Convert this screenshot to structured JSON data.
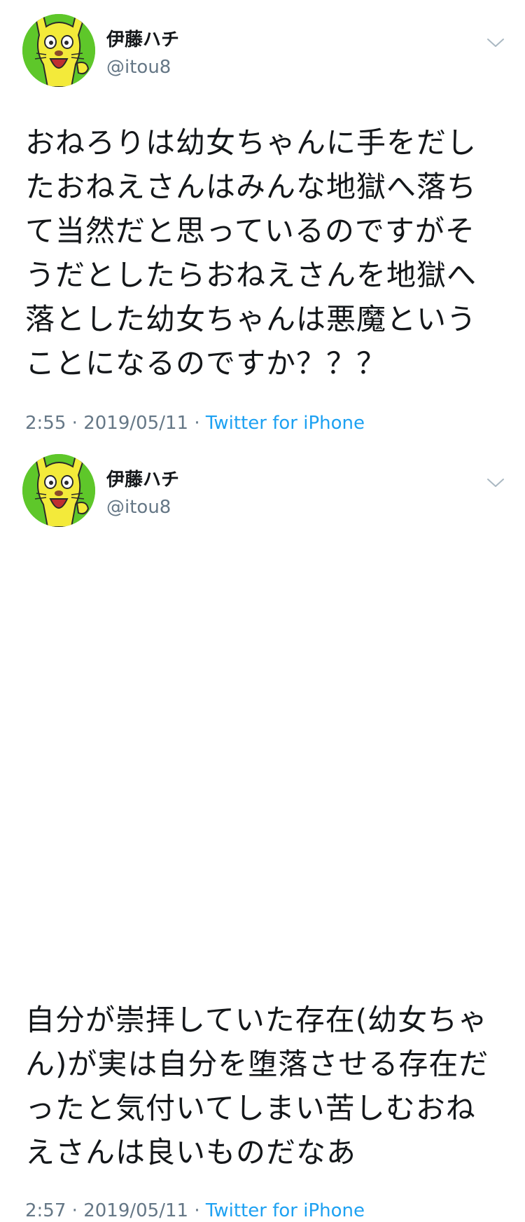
{
  "colors": {
    "text": "#14171a",
    "secondary": "#657786",
    "link": "#1da1f2",
    "avatar_bg": "#5ec72a",
    "avatar_character": "#f3ea3a"
  },
  "tweets": [
    {
      "display_name": "伊藤ハチ",
      "handle": "@itou8",
      "menu_icon": "chevron-down-icon",
      "avatar_icon": "yellow-character-avatar",
      "text": "おねろりは幼女ちゃんに手をだしたおねえさんはみんな地獄へ落ちて当然だと思っているのですがそうだとしたらおねえさんを地獄へ落とした幼女ちゃんは悪魔ということになるのですか？？？",
      "time": "2:55",
      "separator": "·",
      "date": "2019/05/11",
      "client": "Twitter for iPhone"
    },
    {
      "display_name": "伊藤ハチ",
      "handle": "@itou8",
      "menu_icon": "chevron-down-icon",
      "avatar_icon": "yellow-character-avatar",
      "text": "自分が崇拝していた存在(幼女ちゃん)が実は自分を堕落させる存在だったと気付いてしまい苦しむおねえさんは良いものだなあ",
      "time": "2:57",
      "separator": "·",
      "date": "2019/05/11",
      "client": "Twitter for iPhone"
    }
  ]
}
